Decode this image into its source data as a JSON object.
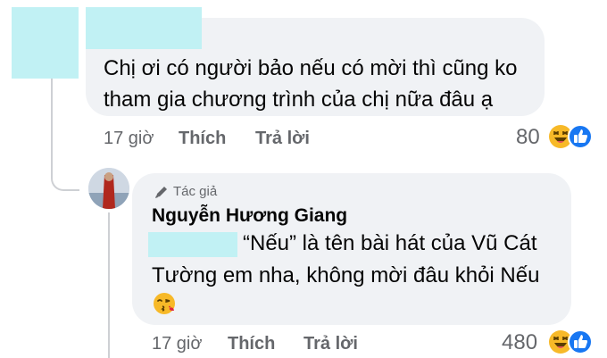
{
  "comment1": {
    "text_line1": "Chị ơi có người bảo nếu có mời thì cũng ko",
    "text_line2": "tham gia chương trình của chị nữa đâu ạ",
    "time": "17 giờ",
    "like": "Thích",
    "reply": "Trả lời",
    "reaction_count": "80"
  },
  "comment2": {
    "badge": "Tác giả",
    "author": "Nguyễn Hương Giang",
    "text_line1": "“Nếu” là tên bài hát của Vũ Cát",
    "text_line2": "Tường em nha, không mời đâu khỏi Nếu",
    "emoji": "😘",
    "time": "17 giờ",
    "like": "Thích",
    "reply": "Trả lời",
    "reaction_count": "480"
  },
  "colors": {
    "bubble": "#f0f2f5",
    "redaction": "#c1f1f4",
    "like_blue": "#1877f2",
    "haha_yellow": "#f7b928"
  },
  "icons": [
    "haha-reaction-icon",
    "like-reaction-icon",
    "pen-icon",
    "kissing-emoji-icon"
  ]
}
